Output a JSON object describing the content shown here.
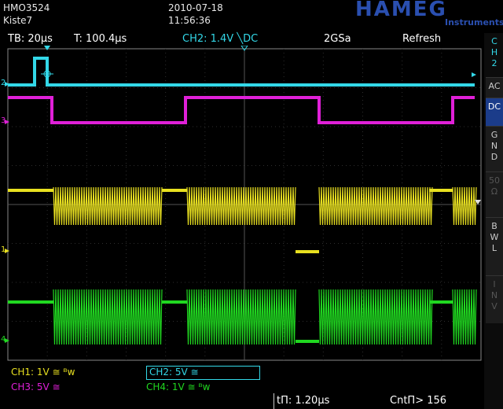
{
  "header": {
    "model": "HMO3524",
    "setup": "Kiste7",
    "date": "2010-07-18",
    "time": "11:56:36",
    "brand": "HAMEG",
    "brand_sub": "Instruments"
  },
  "status": {
    "timebase": "TB: 20µs",
    "trigger_time": "T: 100.4µs",
    "trigger_channel": "CH2: 1.4V ╲DC",
    "sample_rate": "2GSa",
    "mode": "Refresh"
  },
  "side_menu": {
    "channel_label": [
      "C",
      "H",
      "2"
    ],
    "buttons": [
      {
        "label": [
          "AC"
        ],
        "active": false,
        "dim": false
      },
      {
        "label": [
          "DC"
        ],
        "active": true,
        "dim": false
      },
      {
        "label": [
          "G",
          "N",
          "D"
        ],
        "active": false,
        "dim": false
      },
      {
        "label": [
          "50",
          "Ω"
        ],
        "active": false,
        "dim": true
      },
      {
        "label": [
          "B",
          "W",
          "L"
        ],
        "active": false,
        "dim": false
      },
      {
        "label": [
          "I",
          "N",
          "V"
        ],
        "active": false,
        "dim": true
      }
    ]
  },
  "channels": {
    "ch1": {
      "label": "CH1: 1V ≅ ᴮᴡ",
      "color": "#e8e020"
    },
    "ch2": {
      "label": "CH2: 5V ≅",
      "color": "#33d8e8"
    },
    "ch3": {
      "label": "CH3: 5V ≅",
      "color": "#e020d8"
    },
    "ch4": {
      "label": "CH4: 1V ≅ ᴮᴡ",
      "color": "#20d820"
    }
  },
  "markers": {
    "ch2": "2",
    "ch3": "3",
    "ch1": "1",
    "ch4": "4"
  },
  "footer": {
    "pulse_width": "tΠ: 1.20µs",
    "count": "CntΠ> 156"
  },
  "colors": {
    "ch1": "#e8e020",
    "ch2": "#33d8e8",
    "ch3": "#e020d8",
    "ch4": "#20d820",
    "grid": "#2e2e2e",
    "accent": "#1b3c8a"
  }
}
